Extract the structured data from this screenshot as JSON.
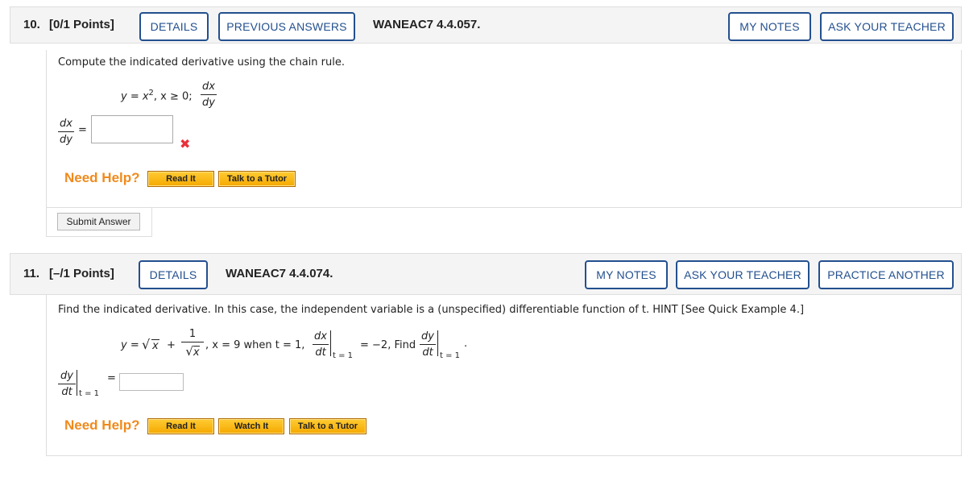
{
  "q10": {
    "number": "10.",
    "points": "[0/1 Points]",
    "details": "DETAILS",
    "previous_answers": "PREVIOUS ANSWERS",
    "code": "WANEAC7 4.4.057.",
    "my_notes": "MY NOTES",
    "ask_teacher": "ASK YOUR TEACHER",
    "prompt": "Compute the indicated derivative using the chain rule.",
    "eq_left": "y = x",
    "eq_exp": "2",
    "eq_mid": ", x ≥ 0;",
    "frac_num": "dx",
    "frac_den": "dy",
    "answer_num": "dx",
    "answer_den": "dy",
    "equals": "=",
    "answer_value": "",
    "need_help": "Need Help?",
    "read_it": "Read It",
    "talk_tutor": "Talk to a Tutor",
    "submit": "Submit Answer",
    "status_icon": "incorrect-x-icon"
  },
  "q11": {
    "number": "11.",
    "points": "[–/1 Points]",
    "details": "DETAILS",
    "code": "WANEAC7 4.4.074.",
    "my_notes": "MY NOTES",
    "ask_teacher": "ASK YOUR TEACHER",
    "practice": "PRACTICE ANOTHER",
    "prompt": "Find the indicated derivative. In this case, the independent variable is a (unspecified) differentiable function of t. HINT [See Quick Example 4.]",
    "eq_y": "y =",
    "sqrt_x": "x",
    "plus": "+",
    "one": "1",
    "eq_rest": ", x = 9 when t = 1,",
    "dx": "dx",
    "dt": "dt",
    "t1": "t = 1",
    "eq_val": "= −2, Find",
    "dy": "dy",
    "period": ".",
    "answer_num": "dy",
    "answer_den": "dt",
    "answer_sub": "t = 1",
    "equals": "=",
    "answer_value": "",
    "need_help": "Need Help?",
    "read_it": "Read It",
    "watch_it": "Watch It",
    "talk_tutor": "Talk to a Tutor"
  },
  "colors": {
    "accent": "#23508f",
    "help": "#f08a1c",
    "error": "#e8313a",
    "help_button": "#f5a800"
  }
}
